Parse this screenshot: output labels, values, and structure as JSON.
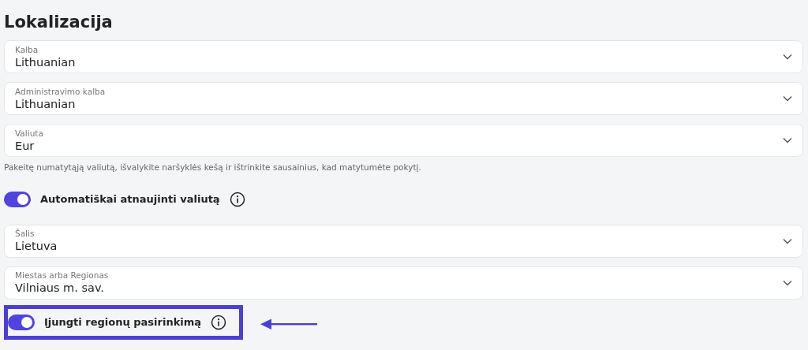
{
  "title": "Lokalizacija",
  "items": [
    {
      "kind": "select",
      "label": "Kalba",
      "value": "Lithuanian"
    },
    {
      "kind": "select",
      "label": "Administravimo kalba",
      "value": "Lithuanian"
    },
    {
      "kind": "select",
      "label": "Valiuta",
      "value": "Eur"
    },
    {
      "kind": "help",
      "text": "Pakeitę numatytąją valiutą, išvalykite naršyklės kešą ir ištrinkite sausainius, kad matytumėte pokytį."
    },
    {
      "kind": "toggle",
      "label": "Automatiškai atnaujinti valiutą",
      "on": true,
      "highlighted": false
    },
    {
      "kind": "select",
      "label": "Šalis",
      "value": "Lietuva"
    },
    {
      "kind": "select",
      "label": "Miestas arba Regionas",
      "value": "Vilniaus m. sav."
    },
    {
      "kind": "toggle",
      "label": "Įjungti regionų pasirinkimą",
      "on": true,
      "highlighted": true
    }
  ]
}
